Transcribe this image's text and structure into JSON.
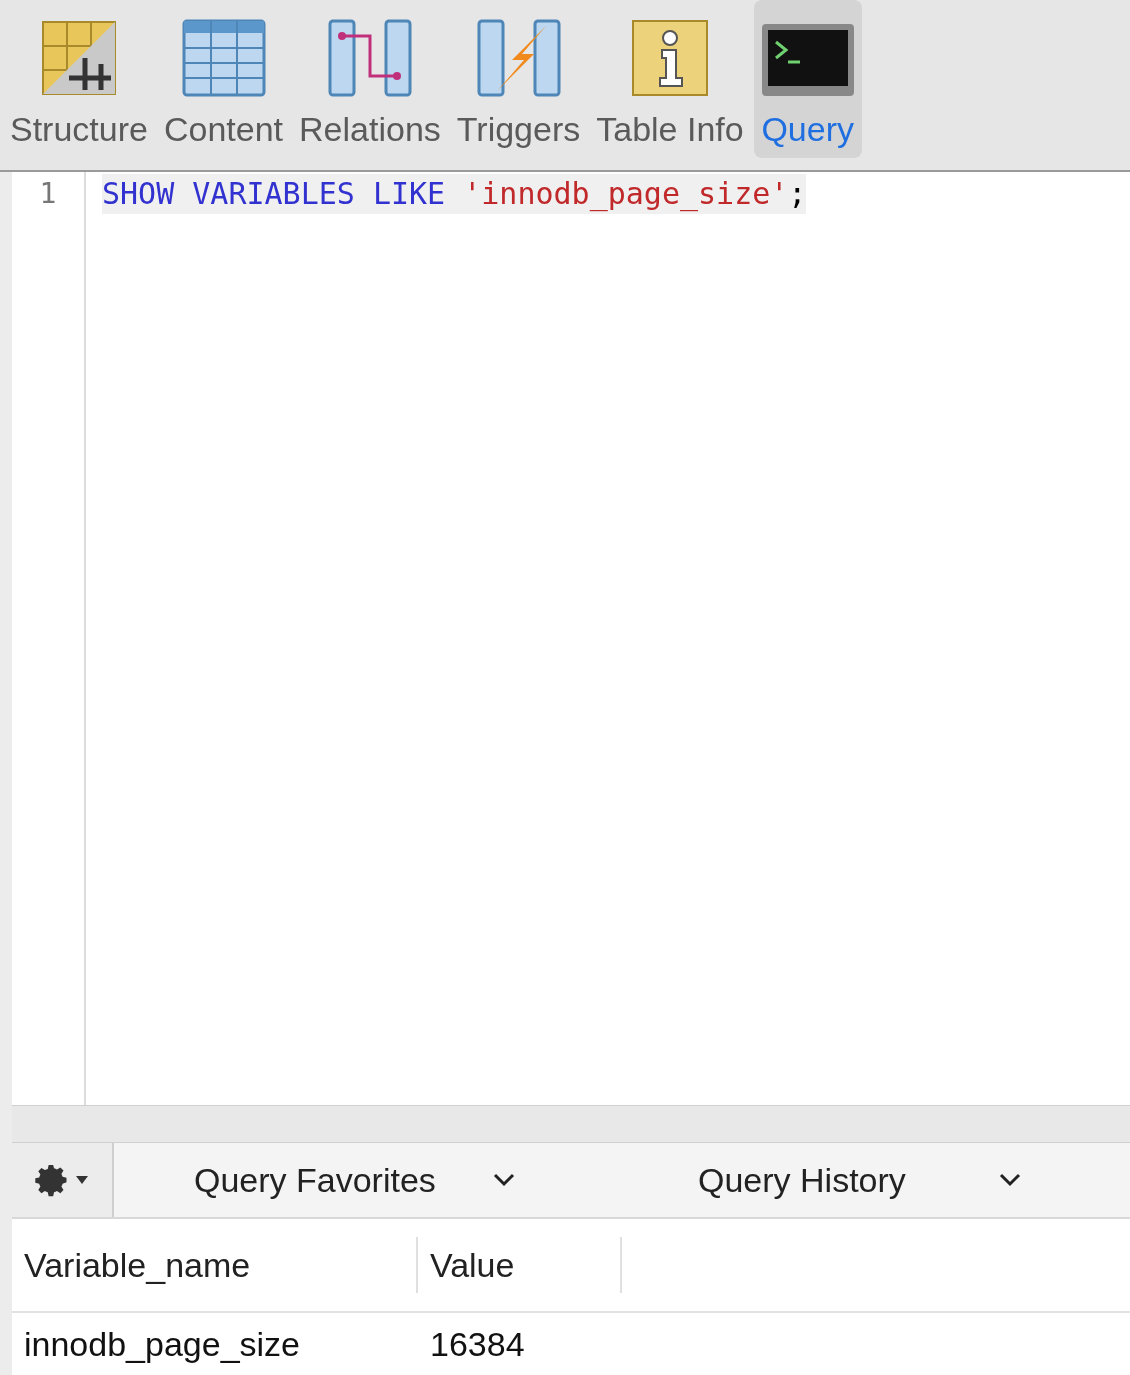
{
  "tabs": [
    {
      "label": "Structure",
      "selected": false
    },
    {
      "label": "Content",
      "selected": false
    },
    {
      "label": "Relations",
      "selected": false
    },
    {
      "label": "Triggers",
      "selected": false
    },
    {
      "label": "Table Info",
      "selected": false
    },
    {
      "label": "Query",
      "selected": true
    }
  ],
  "editor": {
    "lines": [
      {
        "number": "1",
        "tokens": [
          {
            "kind": "keyword",
            "text": "SHOW VARIABLES LIKE "
          },
          {
            "kind": "string",
            "text": "'innodb_page_size'"
          },
          {
            "kind": "plain",
            "text": ";"
          }
        ]
      }
    ]
  },
  "query_toolbar": {
    "favorites": "Query Favorites",
    "history": "Query History"
  },
  "results": {
    "columns": [
      "Variable_name",
      "Value"
    ],
    "rows": [
      [
        "innodb_page_size",
        "16384"
      ]
    ]
  }
}
